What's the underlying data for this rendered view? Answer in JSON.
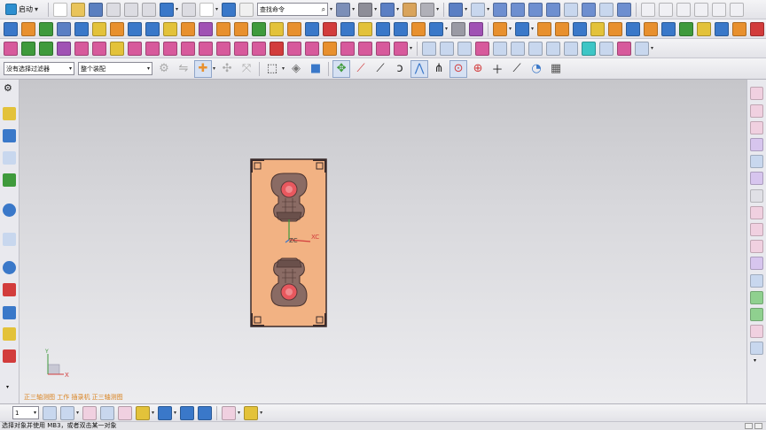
{
  "toolbar": {
    "start_label": "启动",
    "command_search_value": "查找命令",
    "colors": {
      "blue": "#3a78c9",
      "orange": "#e8902e",
      "green": "#3f9a3c",
      "red": "#d23c3c",
      "purple": "#a052b4",
      "gray": "#9a9aa4",
      "yellow": "#e3c23a",
      "pink": "#d75a9c"
    }
  },
  "selection": {
    "filter_value": "没有选择过滤器",
    "scope_value": "整个装配"
  },
  "viewport": {
    "view_label": "正三轴测图  工作 插录机 正三轴测图",
    "csys_labels": {
      "zc": "ZC",
      "xc": "XC"
    },
    "triad_labels": {
      "x": "X",
      "y": "Y"
    },
    "part_color": "#f2b283",
    "cavity_color": "#8a6b64",
    "hole_color": "#e8585e"
  },
  "bottom_toolbar": {
    "layer_value": "1"
  },
  "status": {
    "message": "选择对象并使用 MB3，或者双击某一对象"
  }
}
